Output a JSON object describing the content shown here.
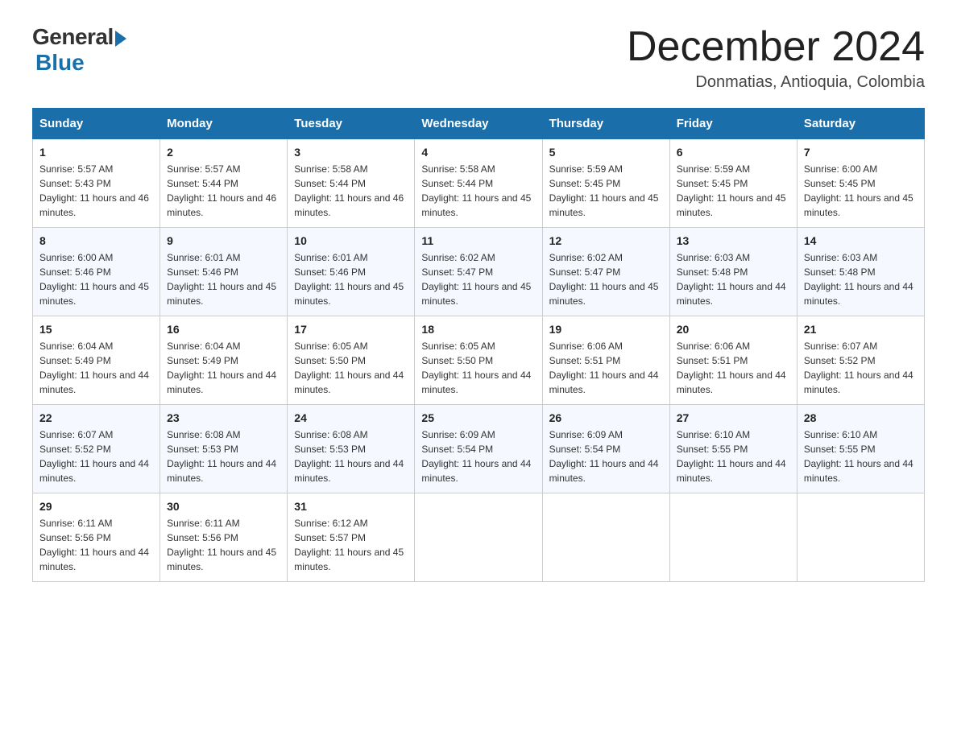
{
  "logo": {
    "general": "General",
    "blue": "Blue"
  },
  "title": {
    "month_year": "December 2024",
    "location": "Donmatias, Antioquia, Colombia"
  },
  "days_of_week": [
    "Sunday",
    "Monday",
    "Tuesday",
    "Wednesday",
    "Thursday",
    "Friday",
    "Saturday"
  ],
  "weeks": [
    [
      {
        "day": "1",
        "sunrise": "5:57 AM",
        "sunset": "5:43 PM",
        "daylight": "11 hours and 46 minutes."
      },
      {
        "day": "2",
        "sunrise": "5:57 AM",
        "sunset": "5:44 PM",
        "daylight": "11 hours and 46 minutes."
      },
      {
        "day": "3",
        "sunrise": "5:58 AM",
        "sunset": "5:44 PM",
        "daylight": "11 hours and 46 minutes."
      },
      {
        "day": "4",
        "sunrise": "5:58 AM",
        "sunset": "5:44 PM",
        "daylight": "11 hours and 45 minutes."
      },
      {
        "day": "5",
        "sunrise": "5:59 AM",
        "sunset": "5:45 PM",
        "daylight": "11 hours and 45 minutes."
      },
      {
        "day": "6",
        "sunrise": "5:59 AM",
        "sunset": "5:45 PM",
        "daylight": "11 hours and 45 minutes."
      },
      {
        "day": "7",
        "sunrise": "6:00 AM",
        "sunset": "5:45 PM",
        "daylight": "11 hours and 45 minutes."
      }
    ],
    [
      {
        "day": "8",
        "sunrise": "6:00 AM",
        "sunset": "5:46 PM",
        "daylight": "11 hours and 45 minutes."
      },
      {
        "day": "9",
        "sunrise": "6:01 AM",
        "sunset": "5:46 PM",
        "daylight": "11 hours and 45 minutes."
      },
      {
        "day": "10",
        "sunrise": "6:01 AM",
        "sunset": "5:46 PM",
        "daylight": "11 hours and 45 minutes."
      },
      {
        "day": "11",
        "sunrise": "6:02 AM",
        "sunset": "5:47 PM",
        "daylight": "11 hours and 45 minutes."
      },
      {
        "day": "12",
        "sunrise": "6:02 AM",
        "sunset": "5:47 PM",
        "daylight": "11 hours and 45 minutes."
      },
      {
        "day": "13",
        "sunrise": "6:03 AM",
        "sunset": "5:48 PM",
        "daylight": "11 hours and 44 minutes."
      },
      {
        "day": "14",
        "sunrise": "6:03 AM",
        "sunset": "5:48 PM",
        "daylight": "11 hours and 44 minutes."
      }
    ],
    [
      {
        "day": "15",
        "sunrise": "6:04 AM",
        "sunset": "5:49 PM",
        "daylight": "11 hours and 44 minutes."
      },
      {
        "day": "16",
        "sunrise": "6:04 AM",
        "sunset": "5:49 PM",
        "daylight": "11 hours and 44 minutes."
      },
      {
        "day": "17",
        "sunrise": "6:05 AM",
        "sunset": "5:50 PM",
        "daylight": "11 hours and 44 minutes."
      },
      {
        "day": "18",
        "sunrise": "6:05 AM",
        "sunset": "5:50 PM",
        "daylight": "11 hours and 44 minutes."
      },
      {
        "day": "19",
        "sunrise": "6:06 AM",
        "sunset": "5:51 PM",
        "daylight": "11 hours and 44 minutes."
      },
      {
        "day": "20",
        "sunrise": "6:06 AM",
        "sunset": "5:51 PM",
        "daylight": "11 hours and 44 minutes."
      },
      {
        "day": "21",
        "sunrise": "6:07 AM",
        "sunset": "5:52 PM",
        "daylight": "11 hours and 44 minutes."
      }
    ],
    [
      {
        "day": "22",
        "sunrise": "6:07 AM",
        "sunset": "5:52 PM",
        "daylight": "11 hours and 44 minutes."
      },
      {
        "day": "23",
        "sunrise": "6:08 AM",
        "sunset": "5:53 PM",
        "daylight": "11 hours and 44 minutes."
      },
      {
        "day": "24",
        "sunrise": "6:08 AM",
        "sunset": "5:53 PM",
        "daylight": "11 hours and 44 minutes."
      },
      {
        "day": "25",
        "sunrise": "6:09 AM",
        "sunset": "5:54 PM",
        "daylight": "11 hours and 44 minutes."
      },
      {
        "day": "26",
        "sunrise": "6:09 AM",
        "sunset": "5:54 PM",
        "daylight": "11 hours and 44 minutes."
      },
      {
        "day": "27",
        "sunrise": "6:10 AM",
        "sunset": "5:55 PM",
        "daylight": "11 hours and 44 minutes."
      },
      {
        "day": "28",
        "sunrise": "6:10 AM",
        "sunset": "5:55 PM",
        "daylight": "11 hours and 44 minutes."
      }
    ],
    [
      {
        "day": "29",
        "sunrise": "6:11 AM",
        "sunset": "5:56 PM",
        "daylight": "11 hours and 44 minutes."
      },
      {
        "day": "30",
        "sunrise": "6:11 AM",
        "sunset": "5:56 PM",
        "daylight": "11 hours and 45 minutes."
      },
      {
        "day": "31",
        "sunrise": "6:12 AM",
        "sunset": "5:57 PM",
        "daylight": "11 hours and 45 minutes."
      },
      null,
      null,
      null,
      null
    ]
  ]
}
